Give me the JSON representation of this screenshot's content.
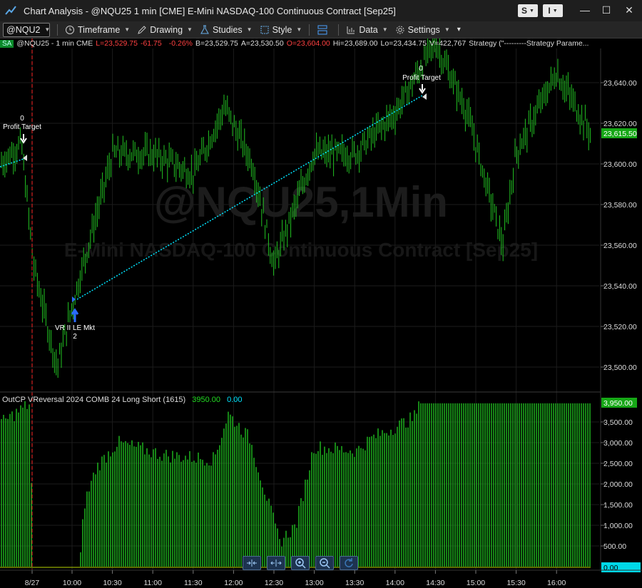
{
  "window": {
    "title": "Chart Analysis - @NQU25 1 min [CME] E-Mini NASDAQ-100 Continuous Contract [Sep25]",
    "btn_s": "S",
    "btn_i": "I"
  },
  "toolbar": {
    "symbol": "@NQU2",
    "timeframe": "Timeframe",
    "drawing": "Drawing",
    "studies": "Studies",
    "style": "Style",
    "data": "Data",
    "settings": "Settings"
  },
  "infobar": {
    "badge": "SA",
    "symbol": "@NQU25 - 1 min  CME",
    "last": "L=23,529.75",
    "change": "-61.75",
    "pct": "-0.26%",
    "bid": "B=23,529.75",
    "ask": "A=23,530.50",
    "open": "O=23,604.00",
    "hi": "Hi=23,689.00",
    "lo": "Lo=23,434.75",
    "vol": "V=422,767",
    "strategy": "Strategy (\"---------Strategy Parame..."
  },
  "watermark": {
    "line1": "@NQU25,1Min",
    "line2": "E-Mini NASDAQ-100 Continuous Contract [Sep25]"
  },
  "annotations": {
    "exit1_count": "0",
    "exit1_label": "Profit Target",
    "exit2_count": "0",
    "exit2_label": "Profit Target",
    "entry_label": "VR II LE Mkt",
    "entry_count": "2"
  },
  "indicator": {
    "name": "OutCP VReversal 2024 COMB 24 Long Short (1615)",
    "value1": "3950.00",
    "value2": "0.00"
  },
  "colors": {
    "bars": "#22c322",
    "hist": "#1fbf1f",
    "price_tag": "#16a716",
    "cyan": "#00e5ff",
    "red_line": "#c41e1e",
    "neg": "#ff4040",
    "pos": "#22dd22"
  },
  "chart_data": [
    {
      "type": "ohlc",
      "y_ticks": [
        "23,640.00",
        "23,620.00",
        "23,600.00",
        "23,580.00",
        "23,560.00",
        "23,540.00",
        "23,520.00",
        "23,500.00"
      ],
      "ylim": [
        23490,
        23680
      ],
      "last_price": "23,615.50",
      "x_ticks": [
        "8/27",
        "10:00",
        "10:30",
        "11:00",
        "11:30",
        "12:00",
        "12:30",
        "13:00",
        "13:30",
        "14:00",
        "14:30",
        "15:00",
        "15:30",
        "16:00"
      ],
      "series": [
        {
          "x": "8/27 start",
          "y": 23600
        },
        {
          "x": "~9:35",
          "y": 23610
        },
        {
          "x": "~9:50",
          "y": 23550
        },
        {
          "x": "~9:57",
          "y": 23500
        },
        {
          "x": "10:02",
          "y": 23530
        },
        {
          "x": "10:30",
          "y": 23605
        },
        {
          "x": "11:00",
          "y": 23605
        },
        {
          "x": "11:30",
          "y": 23595
        },
        {
          "x": "11:55",
          "y": 23628
        },
        {
          "x": "12:20",
          "y": 23600
        },
        {
          "x": "12:35",
          "y": 23550
        },
        {
          "x": "13:00",
          "y": 23605
        },
        {
          "x": "13:30",
          "y": 23605
        },
        {
          "x": "14:00",
          "y": 23625
        },
        {
          "x": "14:30",
          "y": 23660
        },
        {
          "x": "14:55",
          "y": 23625
        },
        {
          "x": "15:10",
          "y": 23560
        },
        {
          "x": "15:30",
          "y": 23605
        },
        {
          "x": "15:55",
          "y": 23645
        },
        {
          "x": "16:05",
          "y": 23615
        }
      ]
    },
    {
      "type": "bar",
      "y_ticks": [
        "3,500.00",
        "3,000.00",
        "2,500.00",
        "2,000.00",
        "1,500.00",
        "1,000.00",
        "500.00"
      ],
      "ylim": [
        0,
        4000
      ],
      "current_high": "3,950.00",
      "current_low": "0.00"
    }
  ]
}
